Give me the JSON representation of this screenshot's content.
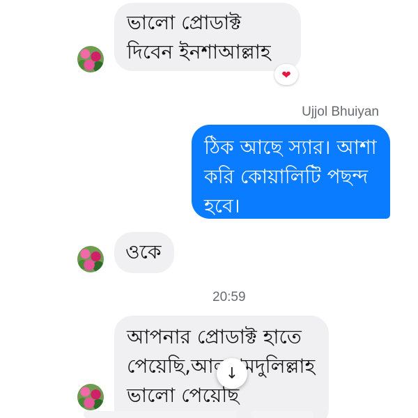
{
  "messages": [
    {
      "direction": "incoming",
      "text": "ভালো প্রোডাক্ট দিবেন ইনশাআল্লাহ",
      "reaction": "heart-icon"
    },
    {
      "direction": "outgoing",
      "sender": "Ujjol Bhuiyan",
      "text": "ঠিক আছে স্যার। আশা করি কোয়ালিটি পছন্দ হবে।"
    },
    {
      "direction": "incoming",
      "text": "ওকে"
    },
    {
      "direction": "incoming",
      "text": "আপনার প্রোডাক্ট হাতে পেয়েছি,আলহামদুলিল্লাহ ভালো পেয়েছি"
    }
  ],
  "timestamp": "20:59",
  "icons": {
    "reaction": "heart-icon",
    "scroll": "arrow-down-icon"
  },
  "colors": {
    "outgoing_bubble": "#0a7cff",
    "incoming_bubble": "#f0f0f3",
    "reaction_heart": "#e5173f"
  }
}
